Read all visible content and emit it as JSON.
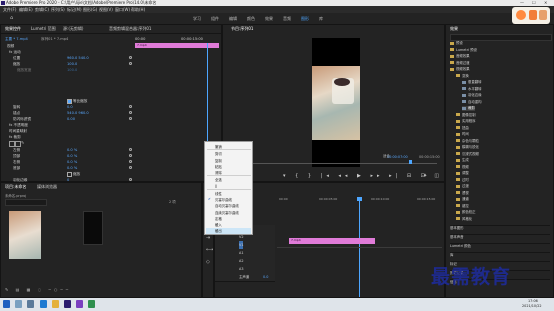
{
  "window": {
    "title": "Adobe Premiere Pro 2020 - C:\\用户\\lijie\\文档\\Adobe\\Premiere Pro\\14.0\\未命名",
    "controls": [
      "—",
      "☐",
      "✕"
    ]
  },
  "menu": [
    "文件(F)",
    "编辑(E)",
    "剪辑(C)",
    "序列(S)",
    "标记(M)",
    "图形(G)",
    "视图(V)",
    "窗口(W)",
    "帮助(H)"
  ],
  "workspaces": {
    "items": [
      "学习",
      "组件",
      "编辑",
      "颜色",
      "效果",
      "音频",
      "图形",
      "库"
    ],
    "active_index": 6
  },
  "effect_controls": {
    "tabs": [
      "效果控件",
      "Lumetri 范围",
      "源:(无剪辑)",
      "音频剪辑混合器:序列01"
    ],
    "source_label": "主要 * 7.mp4",
    "sequence_label": "序列01 * 7.mp4",
    "timecode_start": "00:00",
    "timecode_end": "00:00:15:00",
    "clip_label": "7.mp4",
    "rows": [
      {
        "label": "视频",
        "indent": 0
      },
      {
        "label": "fx 运动",
        "indent": 1
      },
      {
        "label": "位置",
        "indent": 2,
        "value": "960.0   540.0"
      },
      {
        "label": "缩放",
        "indent": 2,
        "value": "100.0"
      },
      {
        "label": "缩放宽度",
        "indent": 3,
        "value": "100.0"
      },
      {
        "label": "等比缩放",
        "indent": 3,
        "checkbox": true
      },
      {
        "label": "旋转",
        "indent": 2,
        "value": "0.0"
      },
      {
        "label": "锚点",
        "indent": 2,
        "value": "540.0   960.0"
      },
      {
        "label": "防闪烁滤镜",
        "indent": 2,
        "value": "0.00"
      },
      {
        "label": "fx 不透明度",
        "indent": 1
      },
      {
        "label": "时间重映射",
        "indent": 1
      },
      {
        "label": "fx 裁剪",
        "indent": 1
      },
      {
        "label": "左侧",
        "indent": 2,
        "value": "0.0 %"
      },
      {
        "label": "顶部",
        "indent": 2,
        "value": "0.0 %"
      },
      {
        "label": "右侧",
        "indent": 2,
        "value": "0.0 %"
      },
      {
        "label": "底部",
        "indent": 2,
        "value": "0.0 %"
      },
      {
        "label": "缩放",
        "indent": 3,
        "checkbox": true
      },
      {
        "label": "羽化边缘",
        "indent": 2,
        "value": "0"
      }
    ],
    "bottom_timecode": "00:00:07:00"
  },
  "program_monitor": {
    "tab": "节目:序列01",
    "zoom": "适合",
    "quality": "完整",
    "timecode": "00:00:07:00",
    "duration": "00:00:15:00"
  },
  "project_panel": {
    "tabs": [
      "项目:未命名",
      "媒体浏览器"
    ],
    "project_file": "未命名.prproj",
    "item_count": "2 项"
  },
  "effects_panel": {
    "tab": "效果",
    "tree": [
      {
        "label": "预设",
        "level": 0
      },
      {
        "label": "Lumetri 预设",
        "level": 0
      },
      {
        "label": "音频效果",
        "level": 0
      },
      {
        "label": "音频过渡",
        "level": 0
      },
      {
        "label": "视频效果",
        "level": 0
      },
      {
        "label": "变换",
        "level": 1
      },
      {
        "label": "垂直翻转",
        "level": 2
      },
      {
        "label": "水平翻转",
        "level": 2
      },
      {
        "label": "羽化边缘",
        "level": 2
      },
      {
        "label": "自动重构",
        "level": 2
      },
      {
        "label": "裁剪",
        "level": 2,
        "selected": true
      },
      {
        "label": "图像控制",
        "level": 1
      },
      {
        "label": "实用程序",
        "level": 1
      },
      {
        "label": "扭曲",
        "level": 1
      },
      {
        "label": "时间",
        "level": 1
      },
      {
        "label": "杂色与颗粒",
        "level": 1
      },
      {
        "label": "模糊与锐化",
        "level": 1
      },
      {
        "label": "沉浸式视频",
        "level": 1
      },
      {
        "label": "生成",
        "level": 1
      },
      {
        "label": "视频",
        "level": 1
      },
      {
        "label": "调整",
        "level": 1
      },
      {
        "label": "过时",
        "level": 1
      },
      {
        "label": "过渡",
        "level": 1
      },
      {
        "label": "透视",
        "level": 1
      },
      {
        "label": "通道",
        "level": 1
      },
      {
        "label": "键控",
        "level": 1
      },
      {
        "label": "颜色校正",
        "level": 1
      },
      {
        "label": "风格化",
        "level": 1
      }
    ],
    "sections": [
      "基本图形",
      "基本声音",
      "Lumetri 颜色",
      "库",
      "标记",
      "历史记录",
      "信息"
    ]
  },
  "context_menu": {
    "items": [
      "撤销",
      "剪切",
      "复制",
      "粘贴",
      "清除",
      "全选",
      "||",
      "线性",
      "贝塞尔曲线",
      "自动贝塞尔曲线",
      "连续贝塞尔曲线",
      "定格",
      "缓入",
      "缓出"
    ],
    "separators_after": [
      0,
      4,
      6
    ],
    "checked_index": 8,
    "highlighted_index": 13
  },
  "timeline": {
    "tracks": [
      {
        "name": "V3"
      },
      {
        "name": "V2"
      },
      {
        "name": "V1"
      },
      {
        "name": "A1"
      },
      {
        "name": "A2"
      },
      {
        "name": "A3"
      },
      {
        "name": "主声道",
        "value": "0.0"
      }
    ],
    "clip_label": "7.mp4",
    "ruler": [
      "00:00",
      "00:00:05:00",
      "00:00:10:00",
      "00:00:15:00"
    ]
  },
  "watermark": "最需教育",
  "taskbar": {
    "time": "17:06",
    "date": "2021/10/22"
  }
}
